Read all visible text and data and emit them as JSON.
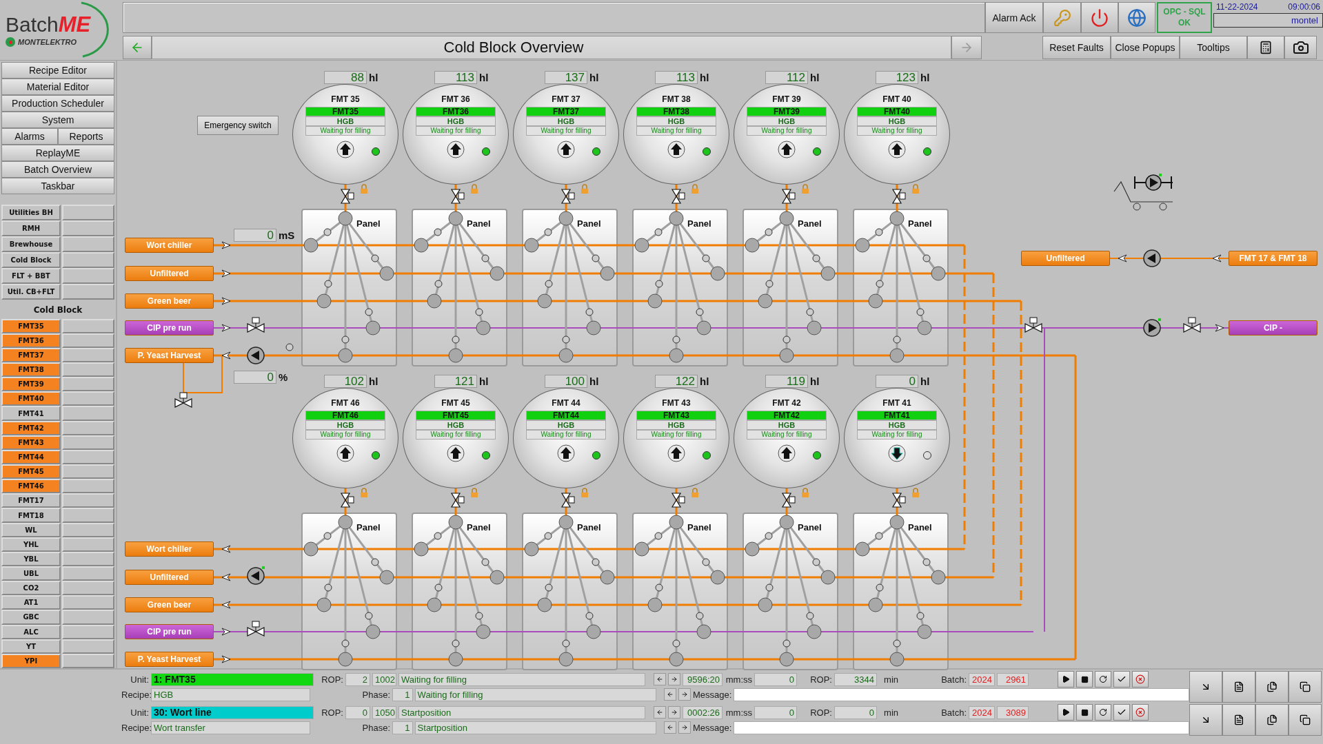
{
  "logo": {
    "brand": "Batch",
    "accent": "ME",
    "maker": "MONTELEKTRO"
  },
  "header": {
    "alarm_ack": "Alarm Ack",
    "opc_status": {
      "line1": "OPC - SQL",
      "line2": "OK"
    },
    "date": "11-22-2024",
    "time": "09:00:06",
    "user": "montel",
    "title": "Cold Block Overview",
    "toolbar": [
      "Reset Faults",
      "Close Popups",
      "Tooltips"
    ]
  },
  "menu": [
    [
      "Recipe Editor"
    ],
    [
      "Material Editor"
    ],
    [
      "Production Scheduler"
    ],
    [
      "System"
    ],
    [
      "Alarms",
      "Reports"
    ],
    [
      "ReplayME"
    ],
    [
      "Batch Overview"
    ],
    [
      "Taskbar"
    ]
  ],
  "areas": [
    "Utilities BH",
    "RMH",
    "Brewhouse",
    "Cold Block",
    "FLT + BBT",
    "Util. CB+FLT"
  ],
  "units_title": "Cold Block",
  "units": [
    {
      "label": "FMT35",
      "active": true
    },
    {
      "label": "FMT36",
      "active": true
    },
    {
      "label": "FMT37",
      "active": true
    },
    {
      "label": "FMT38",
      "active": true
    },
    {
      "label": "FMT39",
      "active": true
    },
    {
      "label": "FMT40",
      "active": true
    },
    {
      "label": "FMT41",
      "active": false
    },
    {
      "label": "FMT42",
      "active": true
    },
    {
      "label": "FMT43",
      "active": true
    },
    {
      "label": "FMT44",
      "active": true
    },
    {
      "label": "FMT45",
      "active": true
    },
    {
      "label": "FMT46",
      "active": true
    },
    {
      "label": "FMT17",
      "active": false
    },
    {
      "label": "FMT18",
      "active": false
    },
    {
      "label": "WL",
      "active": false
    },
    {
      "label": "YHL",
      "active": false
    },
    {
      "label": "YBL",
      "active": false
    },
    {
      "label": "UBL",
      "active": false
    },
    {
      "label": "CO2",
      "active": false
    },
    {
      "label": "AT1",
      "active": false
    },
    {
      "label": "GBC",
      "active": false
    },
    {
      "label": "ALC",
      "active": false
    },
    {
      "label": "YT",
      "active": false
    },
    {
      "label": "YPI",
      "active": true
    }
  ],
  "canvas": {
    "emergency_switch": "Emergency switch",
    "conductivity": {
      "value": "0",
      "unit": "mS"
    },
    "yeast_dosing": {
      "value": "0",
      "unit": "%"
    },
    "rows": [
      {
        "tanks": [
          {
            "volume": "88",
            "unit": "hl",
            "name": "FMT 35",
            "unit_id": "FMT35",
            "recipe": "HGB",
            "status": "Waiting for filling",
            "agitator_down": false,
            "ready": true,
            "panel": "Panel"
          },
          {
            "volume": "113",
            "unit": "hl",
            "name": "FMT 36",
            "unit_id": "FMT36",
            "recipe": "HGB",
            "status": "Waiting for filling",
            "agitator_down": false,
            "ready": true,
            "panel": "Panel"
          },
          {
            "volume": "137",
            "unit": "hl",
            "name": "FMT 37",
            "unit_id": "FMT37",
            "recipe": "HGB",
            "status": "Waiting for filling",
            "agitator_down": false,
            "ready": true,
            "panel": "Panel"
          },
          {
            "volume": "113",
            "unit": "hl",
            "name": "FMT 38",
            "unit_id": "FMT38",
            "recipe": "HGB",
            "status": "Waiting for filling",
            "agitator_down": false,
            "ready": true,
            "panel": "Panel"
          },
          {
            "volume": "112",
            "unit": "hl",
            "name": "FMT 39",
            "unit_id": "FMT39",
            "recipe": "HGB",
            "status": "Waiting for filling",
            "agitator_down": false,
            "ready": true,
            "panel": "Panel"
          },
          {
            "volume": "123",
            "unit": "hl",
            "name": "FMT 40",
            "unit_id": "FMT40",
            "recipe": "HGB",
            "status": "Waiting for filling",
            "agitator_down": false,
            "ready": true,
            "panel": "Panel"
          }
        ],
        "lines": [
          {
            "label": "Wort chiller",
            "kind": "product",
            "points_left": false
          },
          {
            "label": "Unfiltered",
            "kind": "product",
            "points_left": false
          },
          {
            "label": "Green beer",
            "kind": "product",
            "points_left": false
          },
          {
            "label": "CIP pre run",
            "kind": "cip",
            "points_left": false
          },
          {
            "label": "P. Yeast Harvest",
            "kind": "product",
            "points_left": true
          }
        ]
      },
      {
        "tanks": [
          {
            "volume": "102",
            "unit": "hl",
            "name": "FMT 46",
            "unit_id": "FMT46",
            "recipe": "HGB",
            "status": "Waiting for filling",
            "agitator_down": false,
            "ready": true,
            "panel": "Panel"
          },
          {
            "volume": "121",
            "unit": "hl",
            "name": "FMT 45",
            "unit_id": "FMT45",
            "recipe": "HGB",
            "status": "Waiting for filling",
            "agitator_down": false,
            "ready": true,
            "panel": "Panel"
          },
          {
            "volume": "100",
            "unit": "hl",
            "name": "FMT 44",
            "unit_id": "FMT44",
            "recipe": "HGB",
            "status": "Waiting for filling",
            "agitator_down": false,
            "ready": true,
            "panel": "Panel"
          },
          {
            "volume": "122",
            "unit": "hl",
            "name": "FMT 43",
            "unit_id": "FMT43",
            "recipe": "HGB",
            "status": "Waiting for filling",
            "agitator_down": false,
            "ready": true,
            "panel": "Panel"
          },
          {
            "volume": "119",
            "unit": "hl",
            "name": "FMT 42",
            "unit_id": "FMT42",
            "recipe": "HGB",
            "status": "Waiting for filling",
            "agitator_down": false,
            "ready": true,
            "panel": "Panel"
          },
          {
            "volume": "0",
            "unit": "hl",
            "name": "FMT 41",
            "unit_id": "FMT41",
            "recipe": "HGB",
            "status": "Waiting for filling",
            "agitator_down": true,
            "ready": false,
            "panel": "Panel"
          }
        ],
        "lines": [
          {
            "label": "Wort chiller",
            "kind": "product",
            "points_left": true
          },
          {
            "label": "Unfiltered",
            "kind": "product",
            "points_left": true
          },
          {
            "label": "Green beer",
            "kind": "product",
            "points_left": true
          },
          {
            "label": "CIP pre run",
            "kind": "cip",
            "points_left": false
          },
          {
            "label": "P. Yeast Harvest",
            "kind": "product",
            "points_left": false
          }
        ]
      }
    ],
    "transfer": {
      "target": {
        "label": "Unfiltered",
        "kind": "product"
      },
      "source": {
        "label": "FMT 17 & FMT 18",
        "kind": "product"
      }
    },
    "cip_return": {
      "label": "CIP -",
      "kind": "cip"
    }
  },
  "status_rows": [
    {
      "unit": {
        "label": "Unit:",
        "value": "1: FMT35",
        "color": "#11d811"
      },
      "rop": {
        "label": "ROP:",
        "step": "2",
        "code": "1002",
        "text": "Waiting for filling"
      },
      "time": {
        "value": "9596:20",
        "unit": "mm:ss"
      },
      "counter": "0",
      "rop_time": {
        "label": "ROP:",
        "value": "3344",
        "unit": "min"
      },
      "batch": {
        "label": "Batch:",
        "year": "2024",
        "number": "2961"
      },
      "recipe": {
        "label": "Recipe:",
        "value": "HGB"
      },
      "phase": {
        "label": "Phase:",
        "step": "1",
        "text": "Waiting for filling"
      },
      "message": {
        "label": "Message:"
      }
    },
    {
      "unit": {
        "label": "Unit:",
        "value": "30: Wort line",
        "color": "#00cccc"
      },
      "rop": {
        "label": "ROP:",
        "step": "0",
        "code": "1050",
        "text": "Startposition"
      },
      "time": {
        "value": "0002:26",
        "unit": "mm:ss"
      },
      "counter": "0",
      "rop_time": {
        "label": "ROP:",
        "value": "0",
        "unit": "min"
      },
      "batch": {
        "label": "Batch:",
        "year": "2024",
        "number": "3089"
      },
      "recipe": {
        "label": "Recipe:",
        "value": "Wort transfer"
      },
      "phase": {
        "label": "Phase:",
        "step": "1",
        "text": "Startposition"
      },
      "message": {
        "label": "Message:"
      }
    }
  ]
}
